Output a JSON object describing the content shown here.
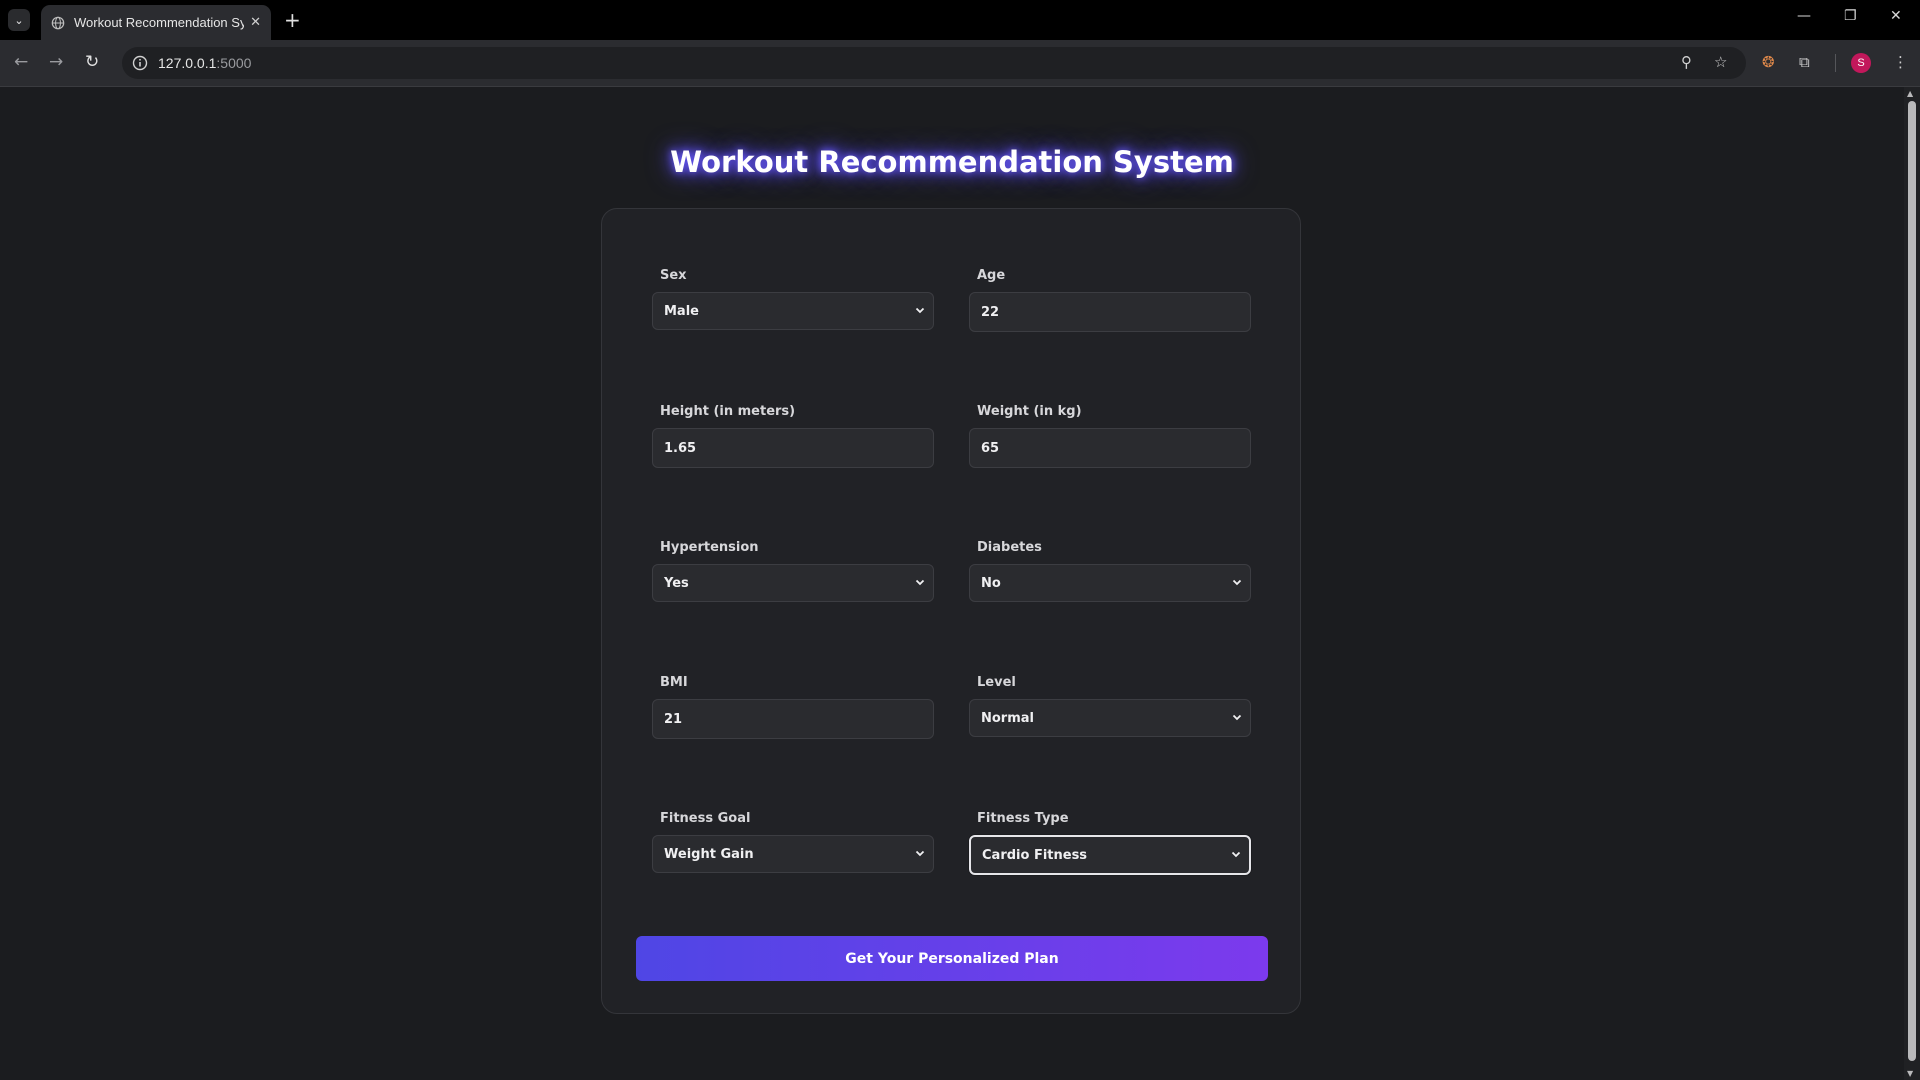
{
  "browser": {
    "tab_title": "Workout Recommendation System",
    "url_host": "127.0.0.1",
    "url_port": ":5000",
    "profile_initial": "S"
  },
  "page": {
    "title": "Workout Recommendation System"
  },
  "form": {
    "sex": {
      "label": "Sex",
      "value": "Male"
    },
    "age": {
      "label": "Age",
      "value": "22"
    },
    "height": {
      "label": "Height (in meters)",
      "value": "1.65"
    },
    "weight": {
      "label": "Weight (in kg)",
      "value": "65"
    },
    "hypertension": {
      "label": "Hypertension",
      "value": "Yes"
    },
    "diabetes": {
      "label": "Diabetes",
      "value": "No"
    },
    "bmi": {
      "label": "BMI",
      "value": "21"
    },
    "level": {
      "label": "Level",
      "value": "Normal"
    },
    "fitness_goal": {
      "label": "Fitness Goal",
      "value": "Weight Gain"
    },
    "fitness_type": {
      "label": "Fitness Type",
      "value": "Cardio Fitness"
    },
    "submit_label": "Get Your Personalized Plan"
  },
  "colors": {
    "background": "#1b1c1f",
    "card": "#212226",
    "accent_start": "#4f46e5",
    "accent_end": "#7c3aed"
  }
}
